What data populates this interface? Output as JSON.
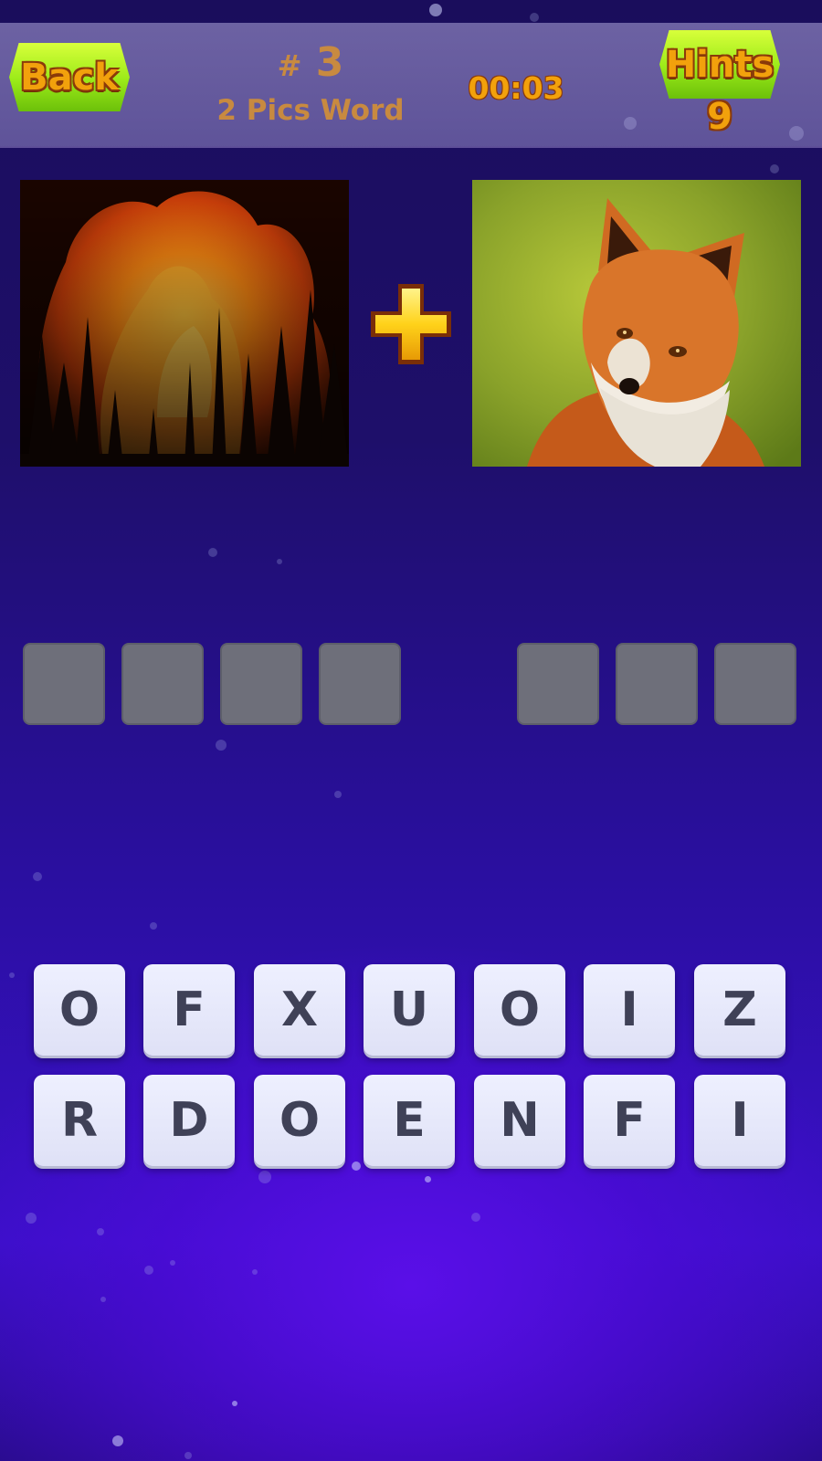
{
  "header": {
    "back_label": "Back",
    "level_hash": "#",
    "level_number": "3",
    "game_title": "2 Pics Word",
    "timer": "00:03",
    "hints_label": "Hints",
    "hints_count": "9"
  },
  "pictures": {
    "left": "forest-fire-picture",
    "right": "fox-picture",
    "combiner": "plus-icon"
  },
  "answer": {
    "first_word_slots": [
      "",
      "",
      "",
      ""
    ],
    "second_word_slots": [
      "",
      "",
      ""
    ]
  },
  "letters": {
    "row1": [
      "O",
      "F",
      "X",
      "U",
      "O",
      "I",
      "Z"
    ],
    "row2": [
      "R",
      "D",
      "O",
      "E",
      "N",
      "F",
      "I"
    ]
  },
  "colors": {
    "button_green": "#9aea18",
    "label_orange": "#f2a10c",
    "slot_gray": "#6e6f7a",
    "tile_bg": "#eef0ff",
    "tile_text": "#3f4157"
  }
}
